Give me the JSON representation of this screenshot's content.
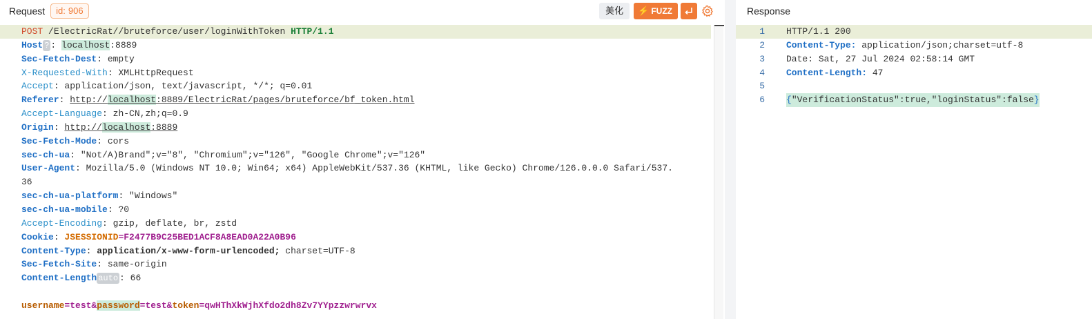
{
  "request": {
    "title": "Request",
    "id_label": "id:",
    "id_value": "906",
    "beautify_label": "美化",
    "fuzz_label": "FUZZ",
    "lines": {
      "method": "POST",
      "path": "/ElectricRat//bruteforce/user/loginWithToken",
      "version": "HTTP/1.1",
      "host_key": "Host",
      "host_tag": "?",
      "host_name": "localhost",
      "host_port": ":8889",
      "sfd_key": "Sec-Fetch-Dest",
      "sfd_val": "empty",
      "xrw_key": "X-Requested-With",
      "xrw_val": "XMLHttpRequest",
      "accept_key": "Accept",
      "accept_val": "application/json, text/javascript, */*; q=0.01",
      "referer_key": "Referer",
      "referer_scheme": "http://",
      "referer_host": "localhost",
      "referer_rest": ":8889/ElectricRat/pages/bruteforce/bf_token.html",
      "al_key": "Accept-Language",
      "al_val": "zh-CN,zh;q=0.9",
      "origin_key": "Origin",
      "origin_scheme": "http://",
      "origin_host": "localhost",
      "origin_rest": ":8889",
      "sfm_key": "Sec-Fetch-Mode",
      "sfm_val": "cors",
      "ua_key": "sec-ch-ua",
      "ua_val": "\"Not/A)Brand\";v=\"8\", \"Chromium\";v=\"126\", \"Google Chrome\";v=\"126\"",
      "useragent_key": "User-Agent",
      "useragent_val": "Mozilla/5.0 (Windows NT 10.0; Win64; x64) AppleWebKit/537.36 (KHTML, like Gecko) Chrome/126.0.0.0 Safari/537.",
      "useragent_cont": "36",
      "platform_key": "sec-ch-ua-platform",
      "platform_val": "\"Windows\"",
      "mobile_key": "sec-ch-ua-mobile",
      "mobile_val": "?0",
      "ae_key": "Accept-Encoding",
      "ae_val": "gzip, deflate, br, zstd",
      "cookie_key": "Cookie",
      "cookie_name": "JSESSIONID",
      "cookie_val": "=F2477B9C25BED1ACF8A8EAD0A22A0B96",
      "ct_key": "Content-Type",
      "ct_val_bold": "application/x-www-form-urlencoded;",
      "ct_val_rest": " charset=UTF-8",
      "sfs_key": "Sec-Fetch-Site",
      "sfs_val": "same-origin",
      "cl_key": "Content-Length",
      "cl_tag": "auto",
      "cl_val": "66",
      "body_k1": "username",
      "body_v1": "=test&",
      "body_k2": "password",
      "body_v2": "=test&",
      "body_k3": "token",
      "body_v3": "=qwHThXkWjhXfdo2dh8Zv7YYpzzwrwrvx"
    }
  },
  "response": {
    "title": "Response",
    "line_numbers": [
      "1",
      "2",
      "3",
      "4",
      "5",
      "6"
    ],
    "status_line": "HTTP/1.1 200",
    "ct_key": "Content-Type:",
    "ct_val": "application/json;charset=utf-8",
    "date_key": "Date:",
    "date_val": "Sat, 27 Jul 2024 02:58:14 GMT",
    "cl_key": "Content-Length:",
    "cl_val": "47",
    "body_open": "{",
    "body_inner": "\"VerificationStatus\":true,\"loginStatus\":false",
    "body_close": "}"
  }
}
